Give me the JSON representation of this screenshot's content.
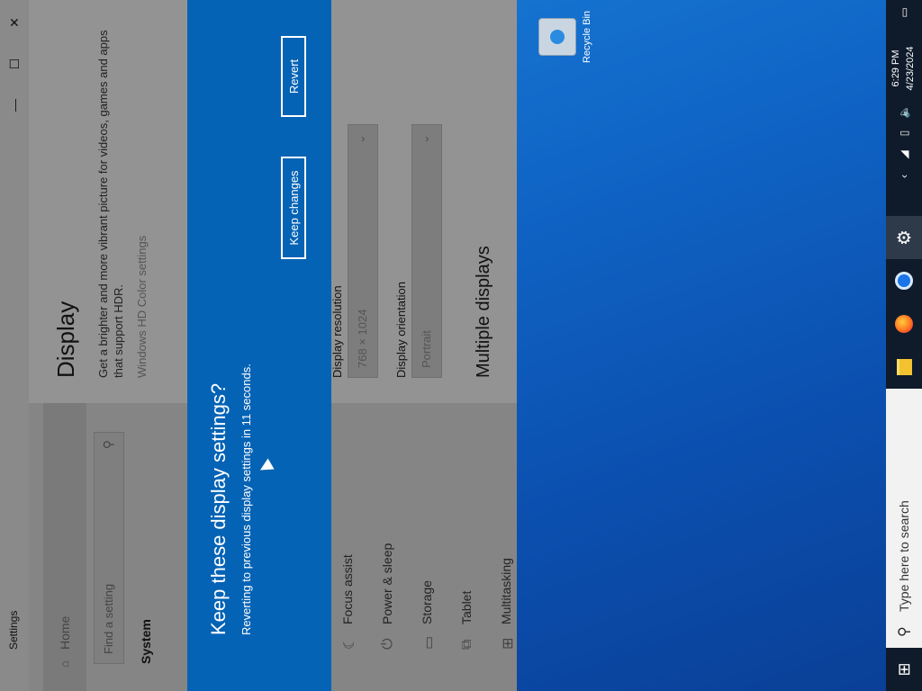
{
  "window": {
    "title": "Settings",
    "minimize": "—",
    "maximize": "☐",
    "close": "✕"
  },
  "sidebar": {
    "home": "Home",
    "search_placeholder": "Find a setting",
    "section": "System",
    "items": [
      {
        "label": "Focus assist"
      },
      {
        "label": "Power & sleep"
      },
      {
        "label": "Storage"
      },
      {
        "label": "Tablet"
      },
      {
        "label": "Multitasking"
      }
    ]
  },
  "content": {
    "title": "Display",
    "hdr_desc": "Get a brighter and more vibrant picture for videos, games and apps that support HDR.",
    "hdr_link": "Windows HD Color settings",
    "resolution_label": "Display resolution",
    "resolution_value": "768 × 1024",
    "orientation_label": "Display orientation",
    "orientation_value": "Portrait",
    "multi_title": "Multiple displays"
  },
  "dialog": {
    "title": "Keep these display settings?",
    "subtitle": "Reverting to previous display settings in 11 seconds.",
    "keep_label": "Keep changes",
    "revert_label": "Revert"
  },
  "desktop": {
    "recycle_bin": "Recycle Bin"
  },
  "taskbar": {
    "search_placeholder": "Type here to search",
    "time": "6:29 PM",
    "date": "4/23/2024",
    "apps": [
      "file-explorer-icon",
      "firefox-icon",
      "chrome-icon",
      "settings-icon"
    ]
  },
  "colors": {
    "dialog_bg": "#0563b5",
    "taskbar_bg": "#0f1b2b",
    "overlay_gray": "#8c8c8c"
  }
}
